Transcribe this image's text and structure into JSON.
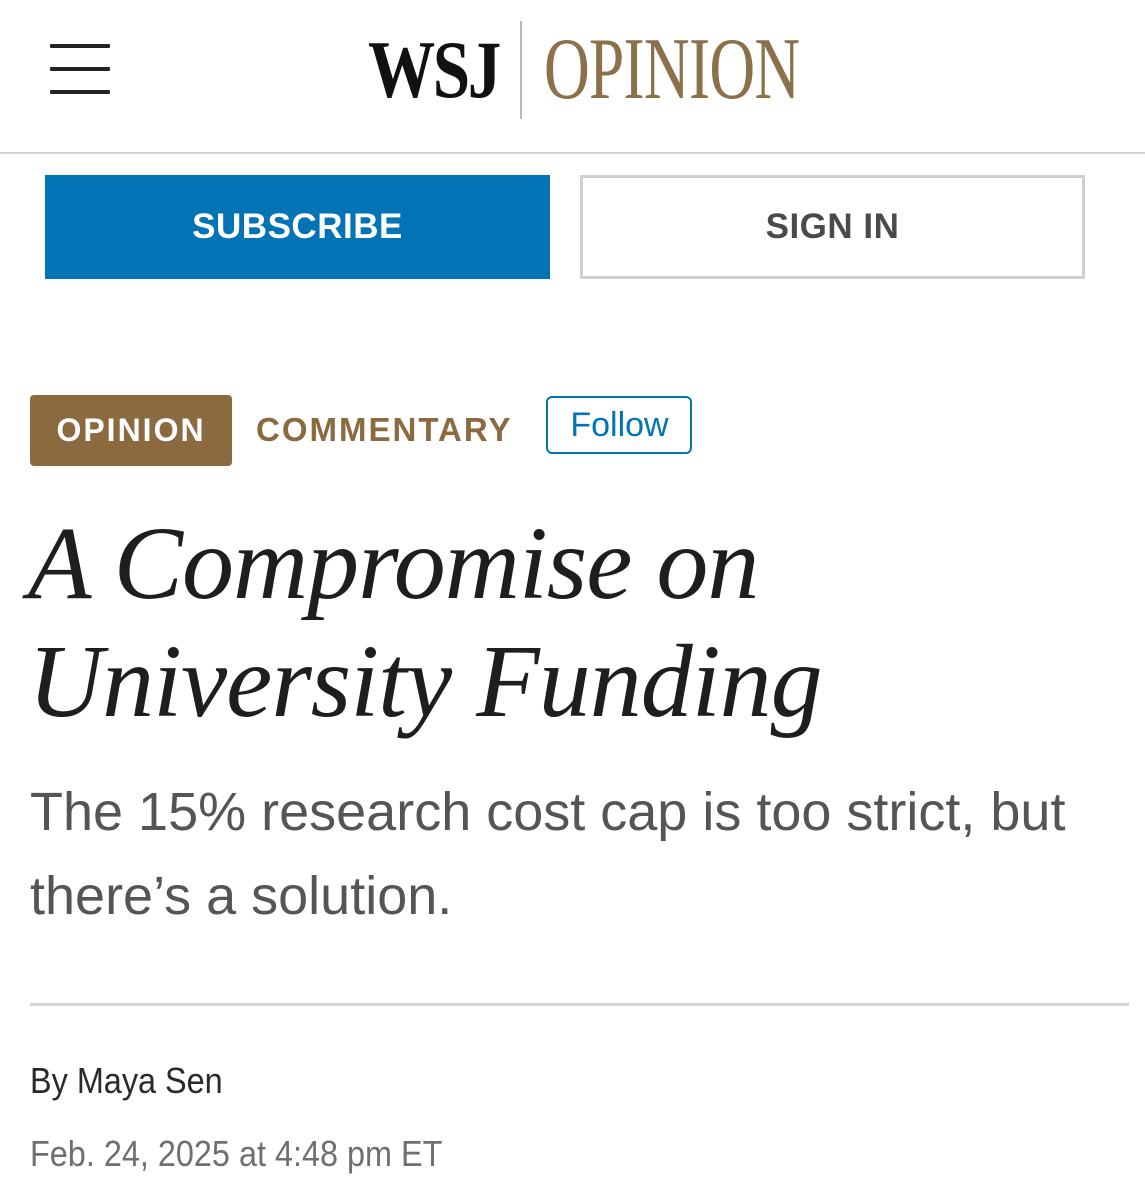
{
  "header": {
    "menu_icon": "hamburger-menu-icon",
    "logo_wsj": "WSJ",
    "logo_section": "OPINION"
  },
  "auth": {
    "subscribe_label": "SUBSCRIBE",
    "signin_label": "SIGN IN"
  },
  "article": {
    "section_badge": "OPINION",
    "category": "COMMENTARY",
    "follow_label": "Follow",
    "headline": "A Compromise on University Funding",
    "dek": "The 15% research cost cap is too strict, but there’s a solution.",
    "byline_prefix": "By ",
    "author": "Maya Sen",
    "timestamp": "Feb. 24, 2025 at 4:48 pm ET"
  },
  "colors": {
    "subscribe_blue": "#0274b6",
    "opinion_brown": "#8b6a40",
    "logo_gold": "#8b7049"
  }
}
